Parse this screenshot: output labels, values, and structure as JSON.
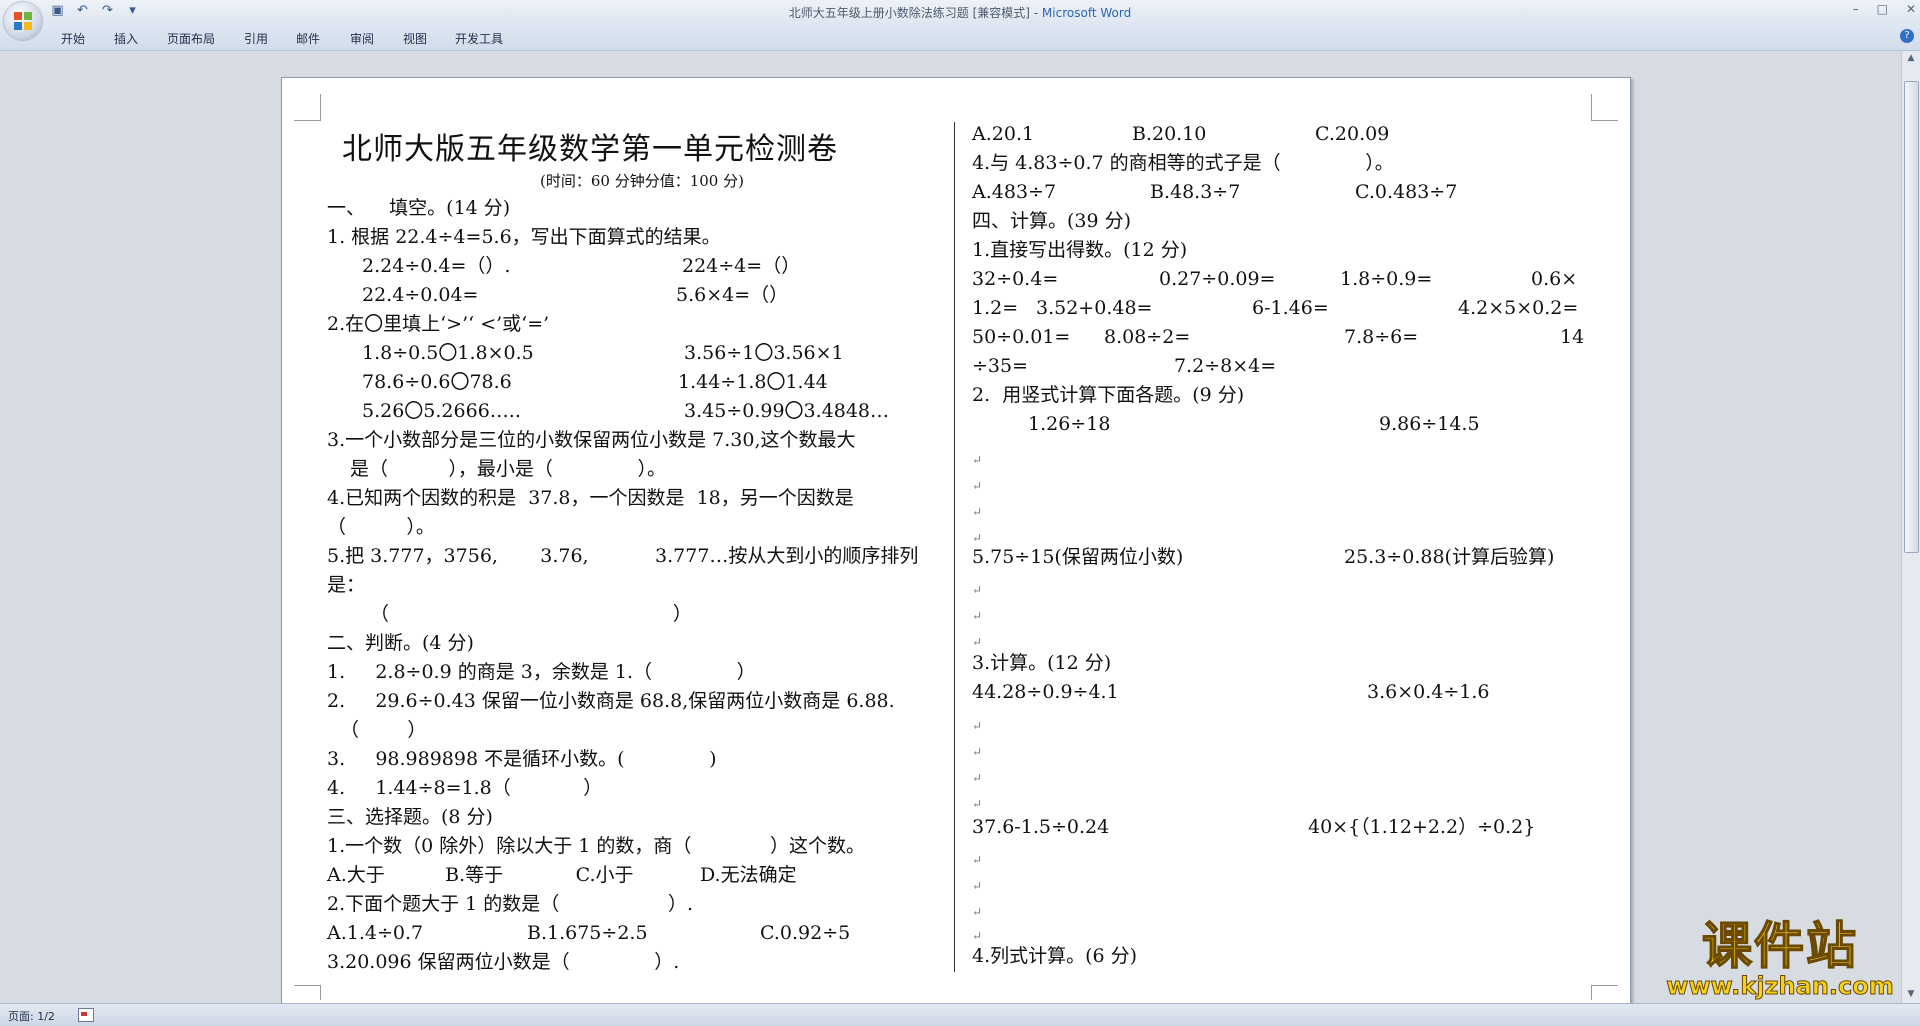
{
  "window": {
    "title_doc": "北师大五年级上册小数除法练习题 [兼容模式] - ",
    "title_app": "Microsoft Word",
    "controls": [
      "–",
      "□",
      "✕"
    ]
  },
  "quick_access": {
    "icons": [
      "save-icon",
      "undo-icon",
      "redo-icon",
      "customize-icon"
    ],
    "glyphs": [
      "▣",
      "↶",
      "↷",
      "▾"
    ]
  },
  "ribbon": {
    "tabs": [
      "开始",
      "插入",
      "页面布局",
      "引用",
      "邮件",
      "审阅",
      "视图",
      "开发工具"
    ],
    "help": "?"
  },
  "document": {
    "title": "北师大版五年级数学第一单元检测卷",
    "subtitle": "(时间：60 分钟分值：100 分)",
    "left_lines": [
      "一、    填空。(14 分)",
      "1. 根据 22.4÷4=5.6，写出下面算式的结果。",
      "2.24÷0.4=（）.",
      "224÷4=（）",
      "22.4÷0.04=",
      "5.6×4=（）",
      "2.在〇里填上‘>’‘ <’或‘=’",
      "1.8÷0.5〇1.8×0.5",
      "3.56÷1〇3.56×1",
      "78.6÷0.6〇78.6",
      "1.44÷1.8〇1.44",
      "5.26〇5.2666…..",
      "3.45÷0.99〇3.4848…",
      "3.一个小数部分是三位的小数保留两位小数是 7.30,这个数最大",
      "是（          ），最小是（              ）。",
      "4.已知两个因数的积是  37.8，一个因数是  18，另一个因数是",
      "（          ）。",
      "5.把 3.777，3756,       3.76,           3.777…按从大到小的顺序排列",
      "是：",
      "（                                               ）",
      "二、判断。(4 分)",
      "1.     2.8÷0.9 的商是 3，余数是 1.（              ）",
      "2.     29.6÷0.43 保留一位小数商是 68.8,保留两位小数商是 6.88.",
      "（        ）",
      "3.     98.989898 不是循环小数。(              )",
      "4.     1.44÷8=1.8（            ）",
      "三、选择题。(8 分)",
      "1.一个数（0 除外）除以大于 1 的数，商（             ）这个数。",
      "A.大于          B.等于            C.小于           D.无法确定",
      "2.下面个题大于 1 的数是（                  ）.",
      "A.1.4÷0.7",
      "B.1.675÷2.5",
      "C.0.92÷5",
      "3.20.096 保留两位小数是（              ）."
    ],
    "right_lines": [
      "A.20.1",
      "B.20.10",
      "C.20.09",
      "4.与 4.83÷0.7 的商相等的式子是（              ）。",
      "A.483÷7",
      "B.48.3÷7",
      "C.0.483÷7",
      "四、计算。(39 分)",
      "1.直接写出得数。(12 分)",
      "32÷0.4=",
      "0.27÷0.09=",
      "1.8÷0.9=",
      "0.6×",
      "1.2=",
      "3.52+0.48=",
      "6-1.46=",
      "4.2×5×0.2=",
      "50÷0.01=",
      "8.08÷2=",
      "7.8÷6=",
      "14",
      "÷35=",
      "7.2÷8×4=",
      "2.  用竖式计算下面各题。(9 分)",
      "1.26÷18",
      "9.86÷14.5",
      "5.75÷15(保留两位小数)",
      "25.3÷0.88(计算后验算)",
      "3.计算。(12 分)",
      "44.28÷0.9÷4.1",
      "3.6×0.4÷1.6",
      "37.6-1.5÷0.24",
      "40×{（1.12+2.2）÷0.2}",
      "4.列式计算。(6 分)"
    ],
    "paragraph_mark": "↵"
  },
  "status": {
    "page": "页面: 1/2"
  },
  "watermark": {
    "big": "课件站",
    "small": "www.kjzhan.com"
  }
}
